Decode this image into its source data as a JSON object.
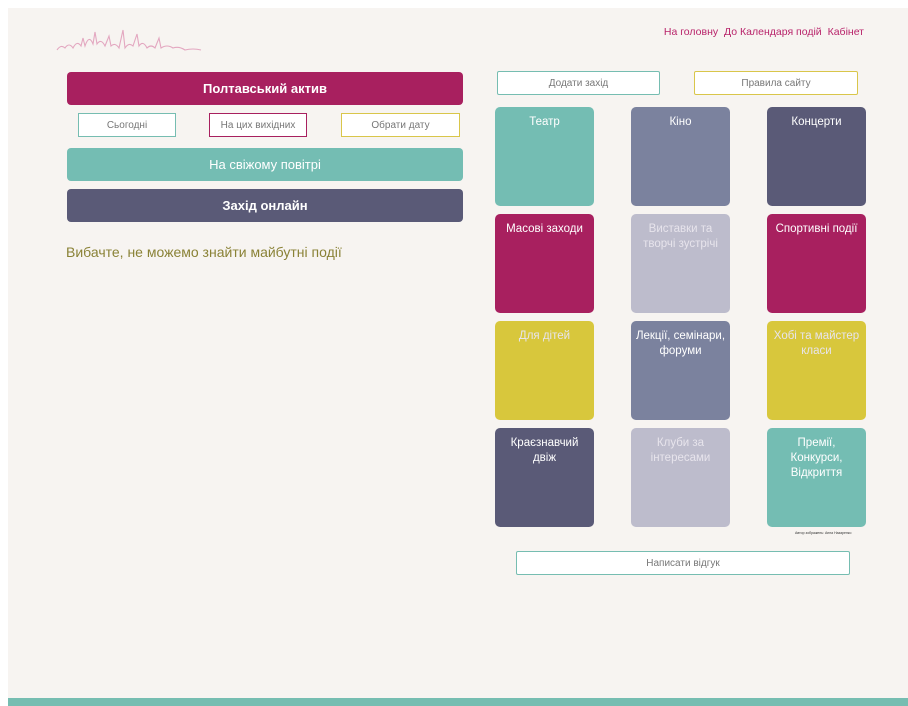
{
  "nav": {
    "home": "На головну",
    "calendar": "До Календаря подій",
    "cabinet": "Кабінет"
  },
  "left": {
    "active_button": "Полтавський актив",
    "filters": {
      "today": "Сьогодні",
      "weekend": "На цих вихідних",
      "pick_date": "Обрати дату"
    },
    "outdoor_button": "На свіжому повітрі",
    "online_button": "Захід онлайн",
    "no_events_message": "Вибачте, не можемо знайти майбутні події"
  },
  "right": {
    "add_event": "Додати захід",
    "site_rules": "Правила сайту",
    "feedback": "Написати відгук",
    "credit": "Автор зображень: Анна Назаренко"
  },
  "categories": [
    {
      "label": "Театр",
      "color": "#74bdb3"
    },
    {
      "label": "Кіно",
      "color": "#7b829e"
    },
    {
      "label": "Концерти",
      "color": "#5a5a77"
    },
    {
      "label": "Масові заходи",
      "color": "#a8205f"
    },
    {
      "label": "Виставки та творчі зустрічі",
      "color": "#bdbccc"
    },
    {
      "label": "Спортивні події",
      "color": "#a8205f"
    },
    {
      "label": "Для дітей",
      "color": "#d8c73c"
    },
    {
      "label": "Лекції, семінари, форуми",
      "color": "#7b829e"
    },
    {
      "label": "Хобі та майстер класи",
      "color": "#d8c73c"
    },
    {
      "label": "Краєзнавчий двіж",
      "color": "#5a5a77"
    },
    {
      "label": "Клуби за інтересами",
      "color": "#bdbccc"
    },
    {
      "label": "Премії, Конкурси, Відкриття",
      "color": "#74bdb3"
    }
  ],
  "colors": {
    "brand": "#a8205f",
    "teal": "#74bdb3",
    "slate": "#5a5a77",
    "mustard": "#d8c73c",
    "background": "#f7f4f1"
  }
}
